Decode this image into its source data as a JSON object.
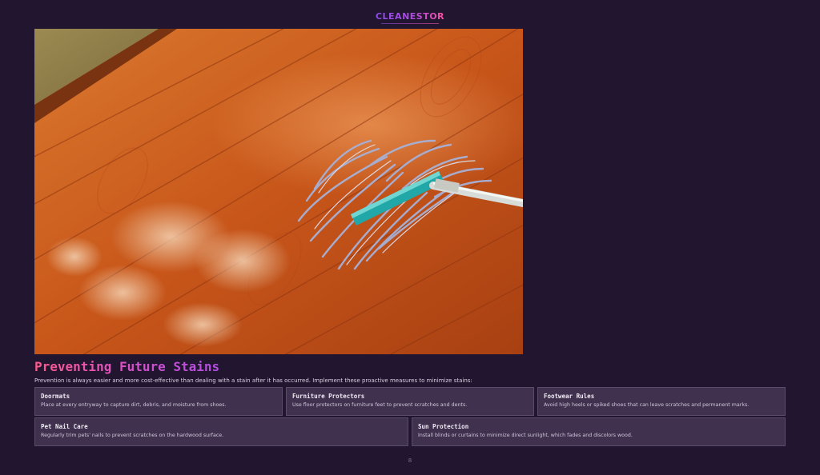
{
  "brand": {
    "logo_text": "CLEANESTOR"
  },
  "hero": {
    "icon": "mop-cleaning-floor-photo"
  },
  "section": {
    "title": "Preventing Future Stains",
    "intro": "Prevention is always easier and more cost-effective than dealing with a stain after it has occurred. Implement these proactive measures to minimize stains:"
  },
  "cards": [
    {
      "title": "Doormats",
      "desc": "Place at every entryway to capture dirt, debris, and moisture from shoes."
    },
    {
      "title": "Furniture Protectors",
      "desc": "Use floor protectors on furniture feet to prevent scratches and dents."
    },
    {
      "title": "Footwear Rules",
      "desc": "Avoid high heels or spiked shoes that can leave scratches and permanent marks."
    },
    {
      "title": "Pet Nail Care",
      "desc": "Regularly trim pets' nails to prevent scratches on the hardwood surface."
    },
    {
      "title": "Sun Protection",
      "desc": "Install blinds or curtains to minimize direct sunlight, which fades and discolors wood."
    }
  ],
  "footer": {
    "page_number": "8"
  },
  "colors": {
    "background": "#211530",
    "card": "#40324f",
    "accent_pink": "#ff5a8a",
    "accent_purple": "#b04ee0"
  }
}
